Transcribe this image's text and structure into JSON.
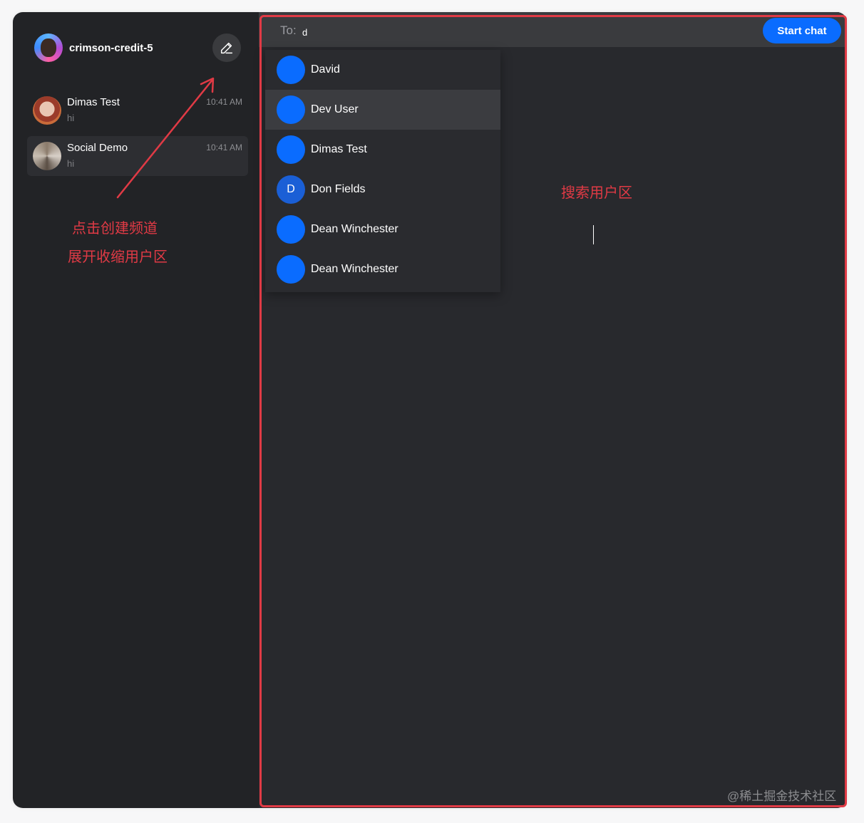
{
  "sidebar": {
    "username": "crimson-credit-5",
    "channels": [
      {
        "name": "Dimas Test",
        "preview": "hi",
        "time": "10:41 AM"
      },
      {
        "name": "Social Demo",
        "preview": "hi",
        "time": "10:41 AM"
      }
    ]
  },
  "annotations": {
    "sidebar_line1": "点击创建频道",
    "sidebar_line2": "展开收缩用户区",
    "main": "搜索用户区"
  },
  "main": {
    "to_label": "To:",
    "search_value": "d",
    "start_button": "Start chat",
    "results": [
      {
        "name": "David",
        "initial": ""
      },
      {
        "name": "Dev User",
        "initial": ""
      },
      {
        "name": "Dimas Test",
        "initial": ""
      },
      {
        "name": "Don Fields",
        "initial": "D"
      },
      {
        "name": "Dean Winchester",
        "initial": ""
      },
      {
        "name": "Dean Winchester",
        "initial": ""
      }
    ]
  },
  "colors": {
    "accent": "#0a6cff",
    "annotation": "#e03a45",
    "sidebar_bg": "#222326",
    "main_bg": "#28292d"
  },
  "icons": {
    "edit": "pencil-icon"
  },
  "watermark": "@稀土掘金技术社区"
}
